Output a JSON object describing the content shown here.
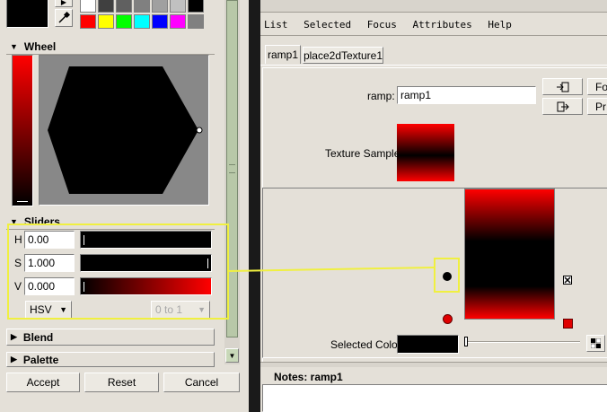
{
  "color_chooser": {
    "current_swatch": "#000000",
    "palette_swatches": [
      "#ffffff",
      "#404040",
      "#606060",
      "#808080",
      "#a0a0a0",
      "#c0c0c0",
      "#000000",
      "#ff0000",
      "#ffff00",
      "#00ff00",
      "#00ffff",
      "#0000ff",
      "#ff00ff",
      "#808080"
    ],
    "wheel": {
      "label": "Wheel",
      "hexagon_color": "#000000"
    },
    "sliders": {
      "label": "Sliders",
      "h": {
        "label": "H",
        "value": "0.00"
      },
      "s": {
        "label": "S",
        "value": "1.000"
      },
      "v": {
        "label": "V",
        "value": "0.000"
      },
      "mode": "HSV",
      "range": "0 to 1"
    },
    "blend_label": "Blend",
    "palette_label": "Palette",
    "buttons": {
      "accept": "Accept",
      "reset": "Reset",
      "cancel": "Cancel"
    },
    "bar_colors": {
      "red": "#ff0000",
      "black": "#000000"
    }
  },
  "attribute_editor": {
    "menu": [
      "List",
      "Selected",
      "Focus",
      "Attributes",
      "Help"
    ],
    "tabs": [
      "ramp1",
      "place2dTexture1"
    ],
    "ramp_label": "ramp:",
    "ramp_value": "ramp1",
    "side_buttons": [
      "Fo",
      "Pr"
    ],
    "texture_sample_label": "Texture Sample",
    "selected_color_label": "Selected Color",
    "selected_color": "#000000",
    "notes_label": "Notes:  ramp1"
  }
}
